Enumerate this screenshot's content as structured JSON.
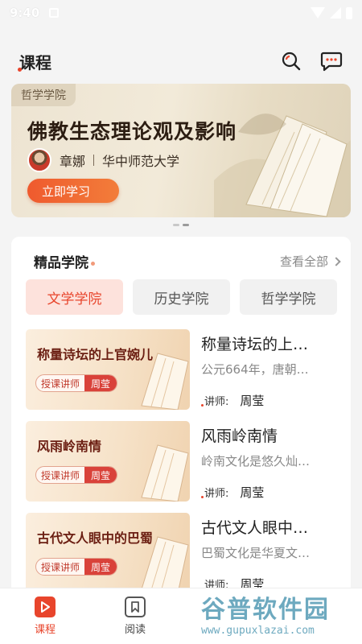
{
  "status_bar": {
    "time": "9:40"
  },
  "header": {
    "title": "课程"
  },
  "banner": {
    "tag": "哲学学院",
    "title": "佛教生态理论观及影响",
    "teacher": "章娜",
    "university": "华中师范大学",
    "cta": "立即学习"
  },
  "section": {
    "title": "精品学院",
    "see_all": "查看全部"
  },
  "tabs": [
    {
      "label": "文学学院",
      "active": true
    },
    {
      "label": "历史学院",
      "active": false
    },
    {
      "label": "哲学学院",
      "active": false
    }
  ],
  "courses": [
    {
      "thumb_title": "称量诗坛的上官婉儿",
      "badge_role": "授课讲师",
      "badge_name": "周莹",
      "title": "称量诗坛的上…",
      "description": "公元664年，唐朝…",
      "teacher_label": "讲师:",
      "teacher": "周莹"
    },
    {
      "thumb_title": "风雨岭南情",
      "badge_role": "授课讲师",
      "badge_name": "周莹",
      "title": "风雨岭南情",
      "description": "岭南文化是悠久灿…",
      "teacher_label": "讲师:",
      "teacher": "周莹"
    },
    {
      "thumb_title": "古代文人眼中的巴蜀",
      "badge_role": "授课讲师",
      "badge_name": "周莹",
      "title": "古代文人眼中…",
      "description": "巴蜀文化是华夏文…",
      "teacher_label": "讲师:",
      "teacher": "周莹"
    }
  ],
  "bottom_nav": [
    {
      "label": "课程",
      "icon": "play-icon",
      "active": true
    },
    {
      "label": "阅读",
      "icon": "bookmark-icon",
      "active": false
    }
  ],
  "watermark": {
    "main": "谷普软件园",
    "sub": "www.gupuxlazai.com"
  },
  "colors": {
    "accent": "#e8452c",
    "tab_active_bg": "#fde2dc"
  }
}
